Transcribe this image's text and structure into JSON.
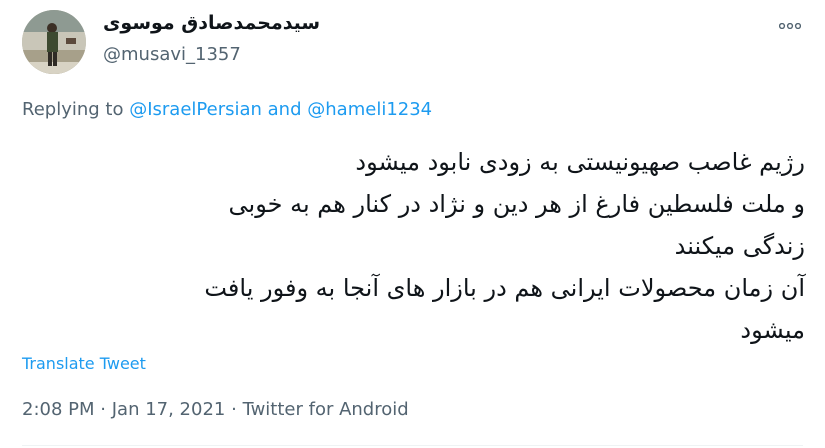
{
  "author": {
    "display_name": "سیدمحمدصادق موسوی",
    "handle": "@musavi_1357"
  },
  "reply": {
    "prefix": "Replying to",
    "mention_1": "@IsraelPersian",
    "connector": "and",
    "mention_2": "@hameli1234"
  },
  "tweet": {
    "lines": [
      "رژیم غاصب صهیونیستی به زودی نابود میشود",
      "و ملت فلسطین فارغ از هر دین و نژاد در کنار هم به خوبی",
      "زندگی میکنند",
      "آن زمان محصولات ایرانی هم در بازار های آنجا به وفور یافت",
      "میشود"
    ]
  },
  "translate_label": "Translate Tweet",
  "meta": {
    "time": "2:08 PM",
    "date": "Jan 17, 2021",
    "separator": "·",
    "source": "Twitter for Android"
  },
  "icons": {
    "more": "more-horizontal-icon"
  },
  "colors": {
    "link": "#1d9bf0",
    "secondary_text": "#536471",
    "primary_text": "#0f1419"
  }
}
